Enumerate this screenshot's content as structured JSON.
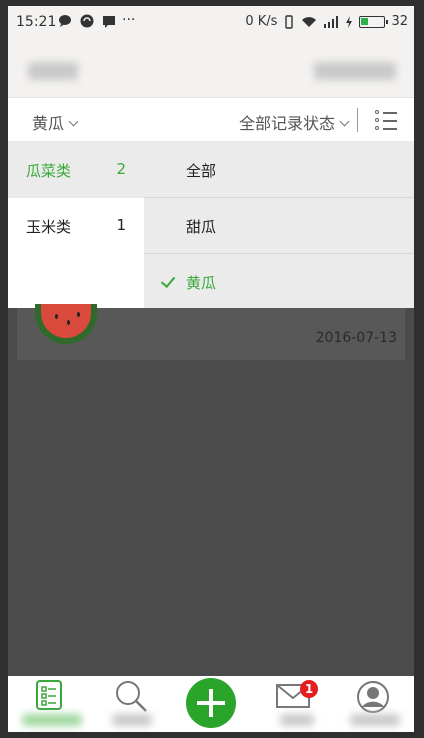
{
  "status_bar": {
    "time": "15:21",
    "network_speed": "0 K/s",
    "battery": "32",
    "battery_level_pct": 32,
    "battery_color": "#2bb24c"
  },
  "filter_bar": {
    "selected_crop": "黄瓜",
    "record_status": "全部记录状态"
  },
  "categories": [
    {
      "name": "瓜菜类",
      "count": "2",
      "active": true
    },
    {
      "name": "玉米类",
      "count": "1",
      "active": false
    }
  ],
  "subcategories": [
    {
      "name": "全部",
      "checked": false
    },
    {
      "name": "甜瓜",
      "checked": false
    },
    {
      "name": "黄瓜",
      "checked": true
    }
  ],
  "record_card": {
    "date": "2016-07-13"
  },
  "tab_bar": {
    "message_badge": "1"
  },
  "colors": {
    "accent": "#39a83a",
    "badge": "#e41e1e",
    "fab": "#2aa52a"
  }
}
